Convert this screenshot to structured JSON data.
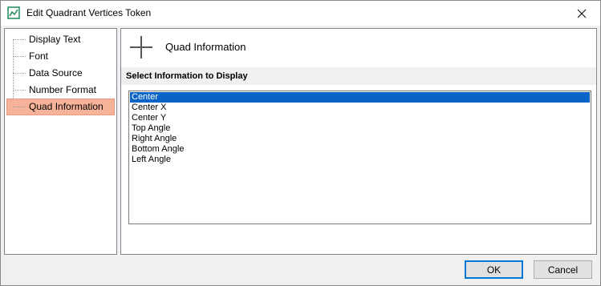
{
  "window": {
    "title": "Edit Quadrant Vertices Token"
  },
  "tree": {
    "items": [
      {
        "label": "Display Text",
        "selected": false
      },
      {
        "label": "Font",
        "selected": false
      },
      {
        "label": "Data Source",
        "selected": false
      },
      {
        "label": "Number Format",
        "selected": false
      },
      {
        "label": "Quad Information",
        "selected": true
      }
    ]
  },
  "content": {
    "header_title": "Quad Information",
    "section_label": "Select Information to Display",
    "list": {
      "items": [
        "Center",
        "Center X",
        "Center Y",
        "Top Angle",
        "Right Angle",
        "Bottom Angle",
        "Left Angle"
      ],
      "selected_index": 0
    }
  },
  "buttons": {
    "ok_label": "OK",
    "cancel_label": "Cancel"
  },
  "colors": {
    "selection_tree": "#f7b29a",
    "selection_list": "#0a64c8",
    "default_button_border": "#0078d7"
  }
}
